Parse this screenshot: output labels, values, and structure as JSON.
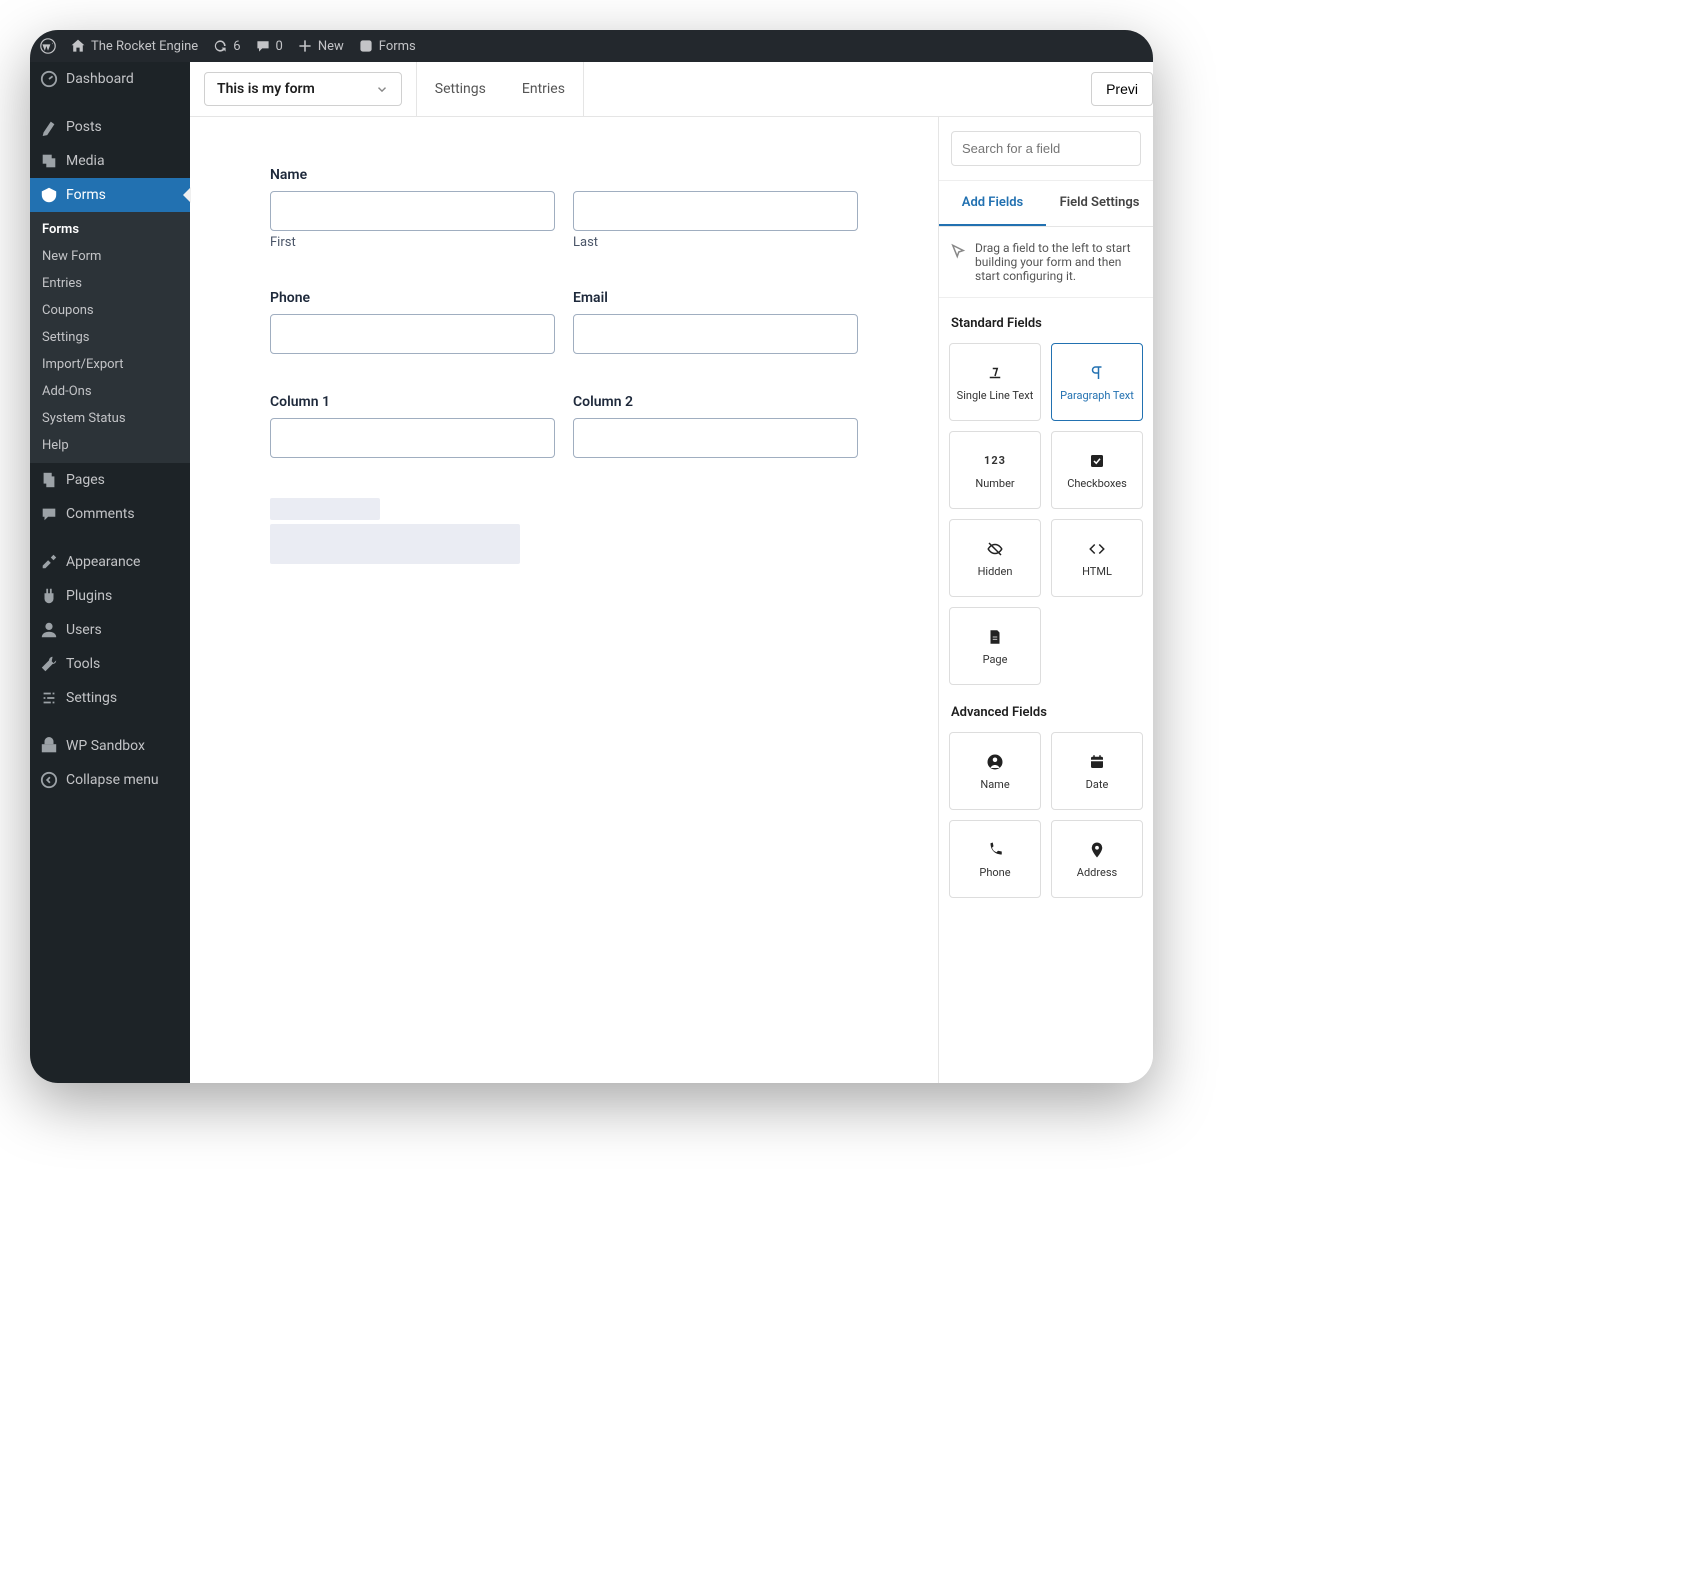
{
  "adminbar": {
    "site_name": "The Rocket Engine",
    "updates_count": "6",
    "comments_count": "0",
    "new_label": "New",
    "context_label": "Forms"
  },
  "sidebar": {
    "dashboard": "Dashboard",
    "posts": "Posts",
    "media": "Media",
    "forms": "Forms",
    "forms_sub": {
      "forms": "Forms",
      "new_form": "New Form",
      "entries": "Entries",
      "coupons": "Coupons",
      "settings": "Settings",
      "import_export": "Import/Export",
      "addons": "Add-Ons",
      "system_status": "System Status",
      "help": "Help"
    },
    "pages": "Pages",
    "comments": "Comments",
    "appearance": "Appearance",
    "plugins": "Plugins",
    "users": "Users",
    "tools": "Tools",
    "settings": "Settings",
    "wp_sandbox": "WP Sandbox",
    "collapse": "Collapse menu"
  },
  "topbar": {
    "form_selector": "This is my form",
    "settings": "Settings",
    "entries": "Entries",
    "preview": "Previ"
  },
  "canvas": {
    "name_label": "Name",
    "first_label": "First",
    "last_label": "Last",
    "phone_label": "Phone",
    "email_label": "Email",
    "col1_label": "Column 1",
    "col2_label": "Column 2"
  },
  "panel": {
    "search_placeholder": "Search for a field",
    "tab_add": "Add Fields",
    "tab_settings": "Field Settings",
    "hint": "Drag a field to the left to start building your form and then start configuring it.",
    "standard_title": "Standard Fields",
    "advanced_title": "Advanced Fields",
    "standard": {
      "single_line": "Single Line Text",
      "paragraph": "Paragraph Text",
      "number": "Number",
      "checkboxes": "Checkboxes",
      "hidden": "Hidden",
      "html": "HTML",
      "page": "Page"
    },
    "advanced": {
      "name": "Name",
      "date": "Date",
      "phone": "Phone",
      "address": "Address"
    }
  }
}
